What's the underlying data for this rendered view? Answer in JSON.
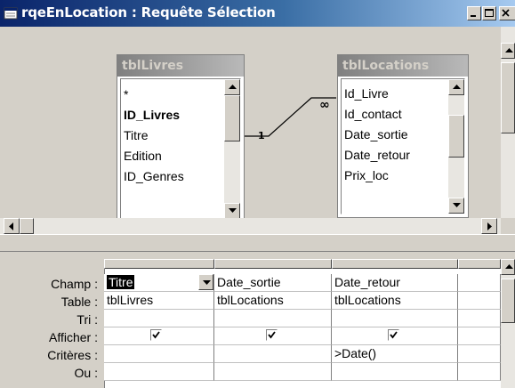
{
  "window": {
    "title": "rqeEnLocation : Requête Sélection",
    "title_color": "#0a246a"
  },
  "tables": [
    {
      "name": "tblLivres",
      "fields": [
        "*",
        "ID_Livres",
        "Titre",
        "Edition",
        "ID_Genres"
      ],
      "bold_field": "ID_Livres"
    },
    {
      "name": "tblLocations",
      "fields": [
        "Id_Livre",
        "Id_contact",
        "Date_sortie",
        "Date_retour",
        "Prix_loc"
      ]
    }
  ],
  "join": {
    "one_label": "1",
    "many_label": "∞"
  },
  "grid": {
    "row_labels": [
      "Champ :",
      "Table :",
      "Tri :",
      "Afficher :",
      "Critères :",
      "Ou :"
    ],
    "columns": [
      {
        "champ": "Titre",
        "table": "tblLivres",
        "tri": "",
        "afficher": true,
        "criteres": "",
        "ou": ""
      },
      {
        "champ": "Date_sortie",
        "table": "tblLocations",
        "tri": "",
        "afficher": true,
        "criteres": "",
        "ou": ""
      },
      {
        "champ": "Date_retour",
        "table": "tblLocations",
        "tri": "",
        "afficher": true,
        "criteres": ">Date()",
        "ou": ""
      }
    ]
  }
}
